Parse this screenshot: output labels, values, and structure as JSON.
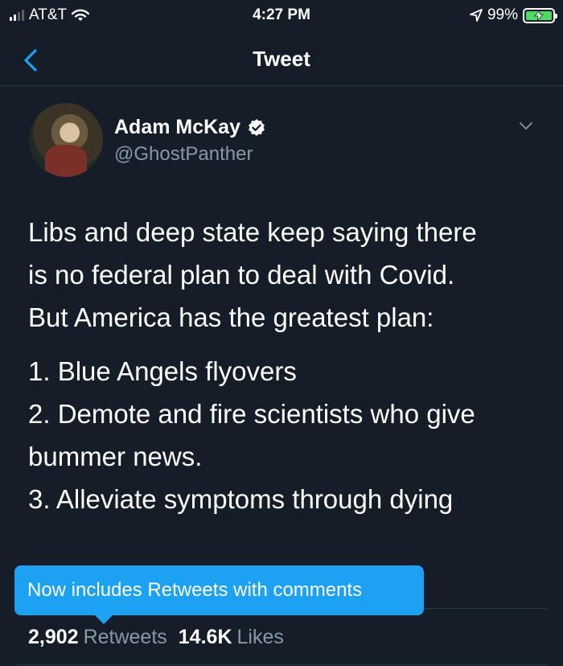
{
  "status_bar": {
    "carrier": "AT&T",
    "time": "4:27 PM",
    "battery": "99%",
    "battery_level": 0.99
  },
  "nav": {
    "title": "Tweet",
    "back_icon": "chevron-left-icon"
  },
  "tweet": {
    "author_name": "Adam McKay",
    "handle": "@GhostPanther",
    "verified": true,
    "body": {
      "line1": "Libs and deep state keep saying there",
      "line2": "is no federal plan to deal with Covid.",
      "line3": "But America has the greatest plan:",
      "line4": "1. Blue Angels flyovers",
      "line5": "2. Demote and fire scientists who give",
      "line6": "bummer news.",
      "line7": "3. Alleviate symptoms through dying"
    }
  },
  "tooltip": {
    "text": "Now includes Retweets with comments"
  },
  "stats": {
    "retweets_count": "2,902",
    "retweets_label": "Retweets",
    "likes_count": "14.6K",
    "likes_label": "Likes"
  },
  "colors": {
    "background": "#151d29",
    "accent": "#1da1f2",
    "secondary_text": "#8899a6"
  }
}
